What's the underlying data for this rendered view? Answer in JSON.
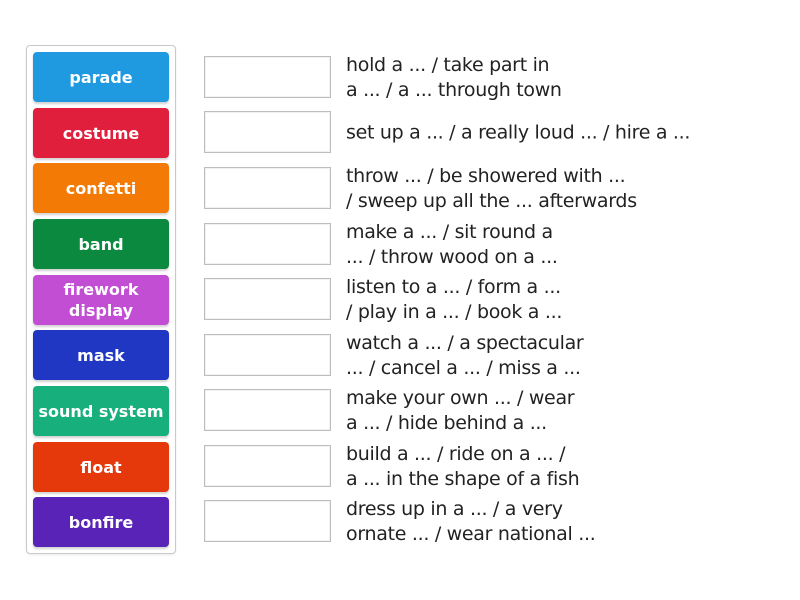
{
  "activity": "match-up",
  "tiles": [
    {
      "label": "parade",
      "color": "#1f9ae0"
    },
    {
      "label": "costume",
      "color": "#e01f3d"
    },
    {
      "label": "confetti",
      "color": "#f47a06"
    },
    {
      "label": "band",
      "color": "#0b8a3f"
    },
    {
      "label": "firework display",
      "color": "#c14ed3"
    },
    {
      "label": "mask",
      "color": "#1f37c2"
    },
    {
      "label": "sound system",
      "color": "#17b07c"
    },
    {
      "label": "float",
      "color": "#e5380b"
    },
    {
      "label": "bonfire",
      "color": "#5a23b8"
    }
  ],
  "targets": [
    {
      "answer": "",
      "clue_lines": [
        "hold a ... / take part in",
        "a ... / a ... through town"
      ]
    },
    {
      "answer": "",
      "clue_lines": [
        "set up a ... / a really loud ... / hire a ..."
      ]
    },
    {
      "answer": "",
      "clue_lines": [
        "throw ... / be showered with ...",
        "/ sweep up all the ... afterwards"
      ]
    },
    {
      "answer": "",
      "clue_lines": [
        "make a ... / sit round a",
        "... / throw wood on a ..."
      ]
    },
    {
      "answer": "",
      "clue_lines": [
        "listen to a ... / form a ...",
        "/ play in a ... / book a ..."
      ]
    },
    {
      "answer": "",
      "clue_lines": [
        "watch a ... / a spectacular",
        "... / cancel a ... / miss a ..."
      ]
    },
    {
      "answer": "",
      "clue_lines": [
        "make your own ... / wear",
        "a ... / hide behind a ..."
      ]
    },
    {
      "answer": "",
      "clue_lines": [
        "build a ... / ride on a ... /",
        "a ... in the shape of a fish"
      ]
    },
    {
      "answer": "",
      "clue_lines": [
        "dress up in a ... / a very",
        "ornate ... / wear national ..."
      ]
    }
  ]
}
